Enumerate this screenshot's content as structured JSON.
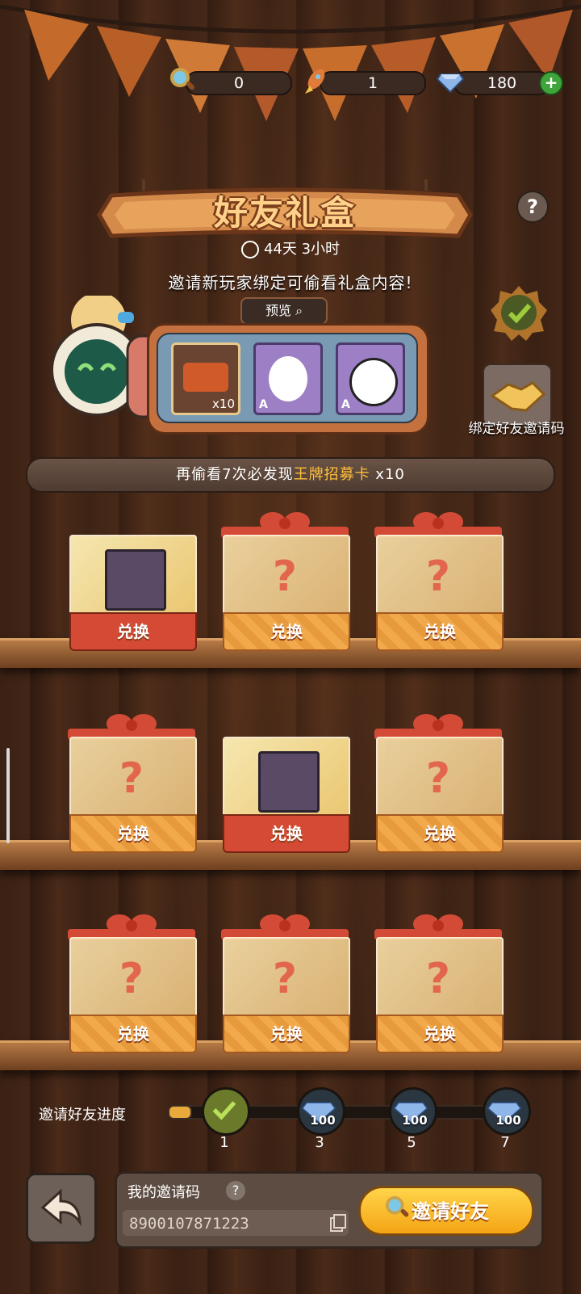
{
  "currency": {
    "magnifier": {
      "value": "0",
      "icon": "magnifier-icon"
    },
    "rocket": {
      "value": "1",
      "icon": "rocket-icon"
    },
    "diamond": {
      "value": "180",
      "icon": "diamond-icon"
    }
  },
  "event": {
    "title": "好友礼盒",
    "timer": "44天  3小时",
    "hint": "邀请新玩家绑定可偷看礼盒内容!",
    "preview_label": "预览",
    "preview_items": [
      {
        "name": "ticket-card",
        "count": "x10",
        "rank": ""
      },
      {
        "name": "duck-character",
        "count": "",
        "rank": "A"
      },
      {
        "name": "dog-character",
        "count": "",
        "rank": "A"
      }
    ],
    "bind_label": "绑定好友邀请码",
    "banner_prefix": "再偷看7次必发现",
    "banner_highlight": "王牌招募卡",
    "banner_suffix": " x10"
  },
  "boxes": [
    {
      "state": "opened",
      "label": "兑换",
      "item": "badge-item"
    },
    {
      "state": "locked",
      "label": "兑换",
      "mystery": "?"
    },
    {
      "state": "locked",
      "label": "兑换",
      "mystery": "?"
    },
    {
      "state": "locked",
      "label": "兑换",
      "mystery": "?"
    },
    {
      "state": "opened",
      "label": "兑换",
      "item": "ring-item"
    },
    {
      "state": "locked",
      "label": "兑换",
      "mystery": "?"
    },
    {
      "state": "locked",
      "label": "兑换",
      "mystery": "?"
    },
    {
      "state": "locked",
      "label": "兑换",
      "mystery": "?"
    },
    {
      "state": "locked",
      "label": "兑换",
      "mystery": "?"
    }
  ],
  "progress": {
    "label": "邀请好友进度",
    "current": 1,
    "max": 7,
    "milestones": [
      {
        "step": "1",
        "reward": "",
        "claimed": true
      },
      {
        "step": "3",
        "reward": "100"
      },
      {
        "step": "5",
        "reward": "100"
      },
      {
        "step": "7",
        "reward": "100"
      }
    ]
  },
  "invite": {
    "title": "我的邀请码",
    "help": "?",
    "code": "8900107871223",
    "button": "邀请好友"
  },
  "colors": {
    "accent": "#f4a514",
    "highlight": "#ffbf3a",
    "box_red": "#d44a34"
  }
}
